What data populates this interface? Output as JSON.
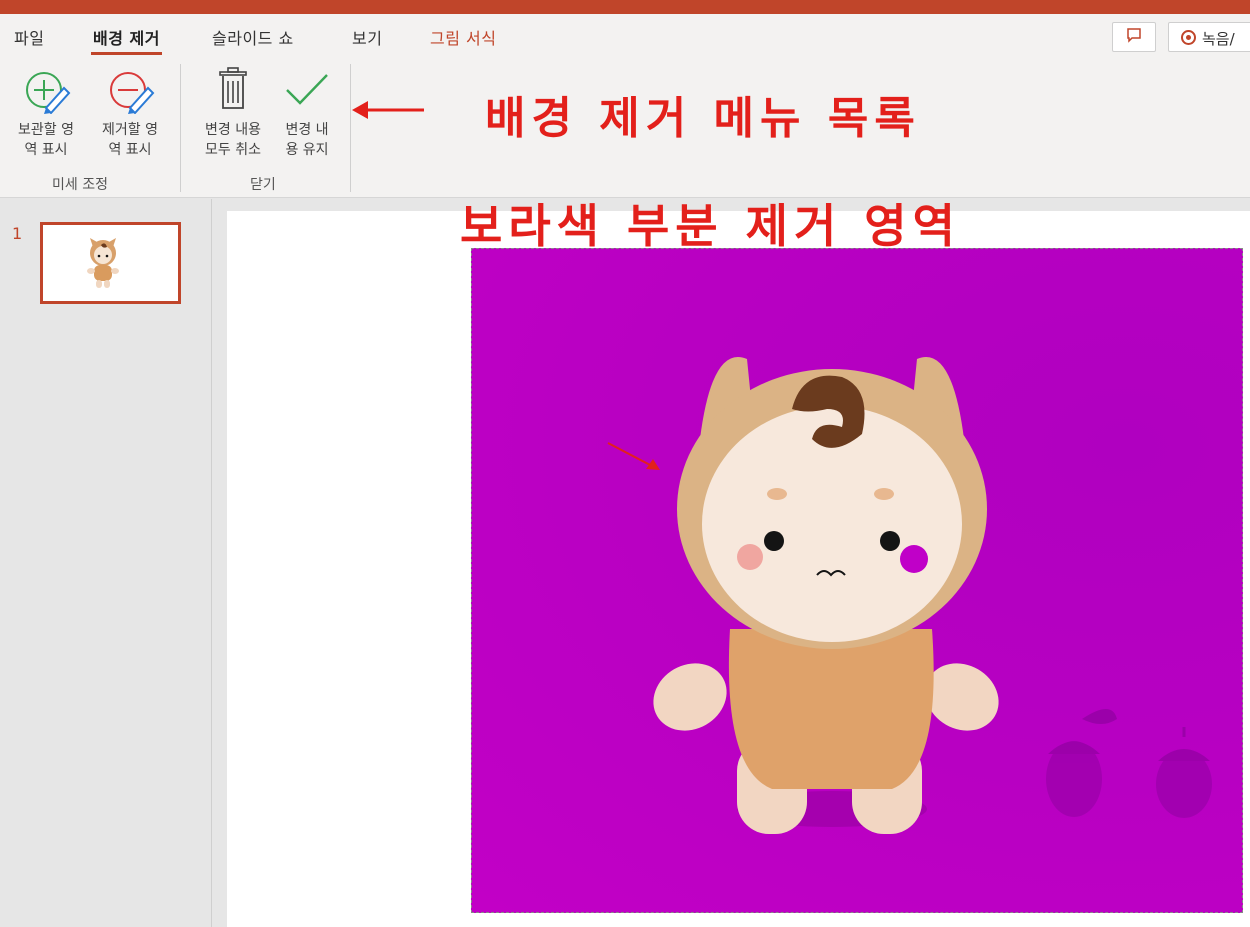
{
  "ribbon_tabs": {
    "file": "파일",
    "background_removal": "배경 제거",
    "slideshow": "슬라이드 쇼",
    "view": "보기",
    "picture_format": "그림 서식"
  },
  "header_actions": {
    "comment_icon": "comment-icon",
    "record_label": "녹음/"
  },
  "ribbon": {
    "refine_group": {
      "label": "미세 조정",
      "mark_keep": {
        "label": "보관할 영\n역 표시",
        "icon": "mark-keep-pencil-icon"
      },
      "mark_remove": {
        "label": "제거할 영\n역 표시",
        "icon": "mark-remove-pencil-icon"
      }
    },
    "close_group": {
      "label": "닫기",
      "discard": {
        "label": "변경 내용\n모두 취소",
        "icon": "trash-icon"
      },
      "keep": {
        "label": "변경 내\n용 유지",
        "icon": "checkmark-icon"
      }
    }
  },
  "annotations": {
    "menu_list": "배경 제거 메뉴 목록",
    "purple_area": "보라색 부분 제거 영역"
  },
  "slides": {
    "current_number": "1"
  },
  "colors": {
    "accent": "#c0452a",
    "annotation": "#e3201b",
    "removal_overlay": "#b800c2"
  }
}
